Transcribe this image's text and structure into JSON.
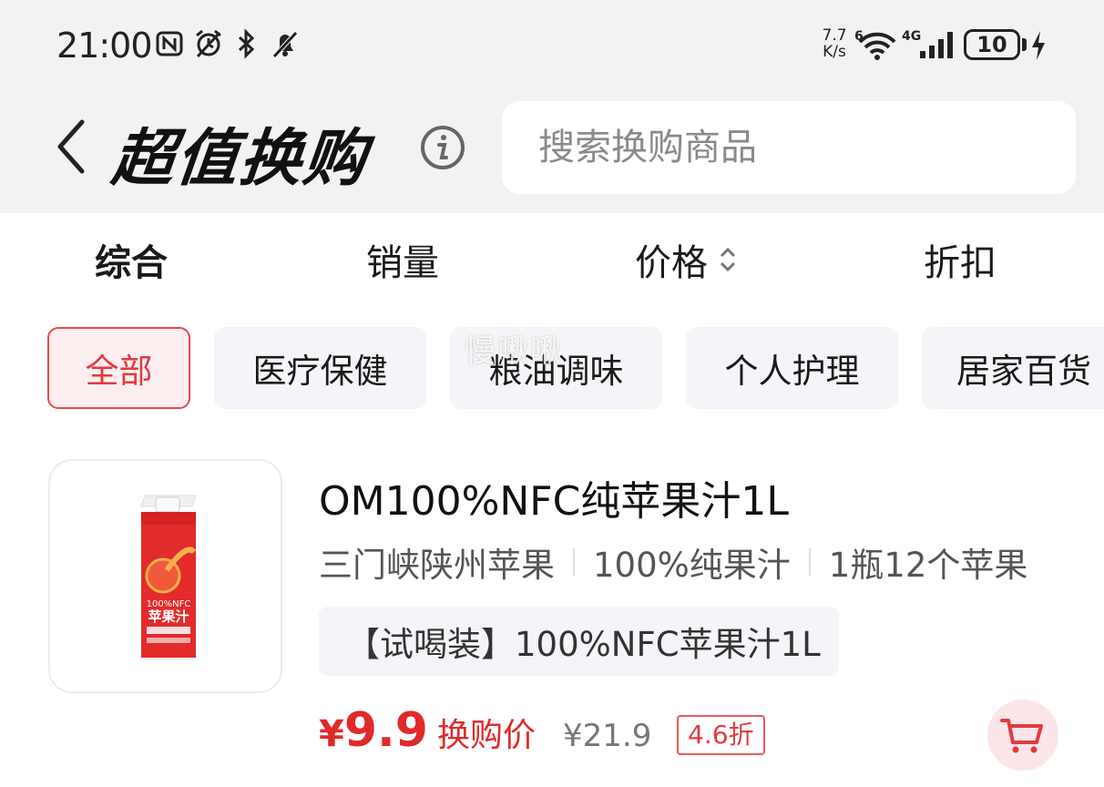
{
  "status_bar": {
    "time": "21:00",
    "net_speed_value": "7.7",
    "net_speed_unit": "K/s",
    "battery": "10",
    "icons": [
      "nfc-icon",
      "alarm-icon",
      "bluetooth-icon",
      "mute-icon",
      "wifi-icon",
      "signal-4g-icon",
      "charging-icon"
    ]
  },
  "header": {
    "title": "超值换购",
    "search_placeholder": "搜索换购商品"
  },
  "sort_tabs": [
    {
      "label": "综合",
      "active": true
    },
    {
      "label": "销量"
    },
    {
      "label": "价格"
    },
    {
      "label": "折扣"
    }
  ],
  "categories": [
    {
      "label": "全部",
      "active": true
    },
    {
      "label": "医疗保健"
    },
    {
      "label": "粮油调味"
    },
    {
      "label": "个人护理"
    },
    {
      "label": "居家百货"
    }
  ],
  "watermark": "慢啾啾",
  "product": {
    "name": "OM100%NFC纯苹果汁1L",
    "tags": [
      "三门峡陕州苹果",
      "100%纯果汁",
      "1瓶12个苹果"
    ],
    "spec": "【试喝装】100%NFC苹果汁1L",
    "price_symbol": "¥",
    "price": "9.9",
    "price_label": "换购价",
    "original_price": "¥21.9",
    "discount": "4.6折",
    "image_text_line1": "100%NFC",
    "image_text_line2": "苹果汁"
  },
  "colors": {
    "accent_red": "#e02a2a",
    "chip_active_bg": "#fdeef0",
    "top_bg": "#f2f2f4"
  }
}
